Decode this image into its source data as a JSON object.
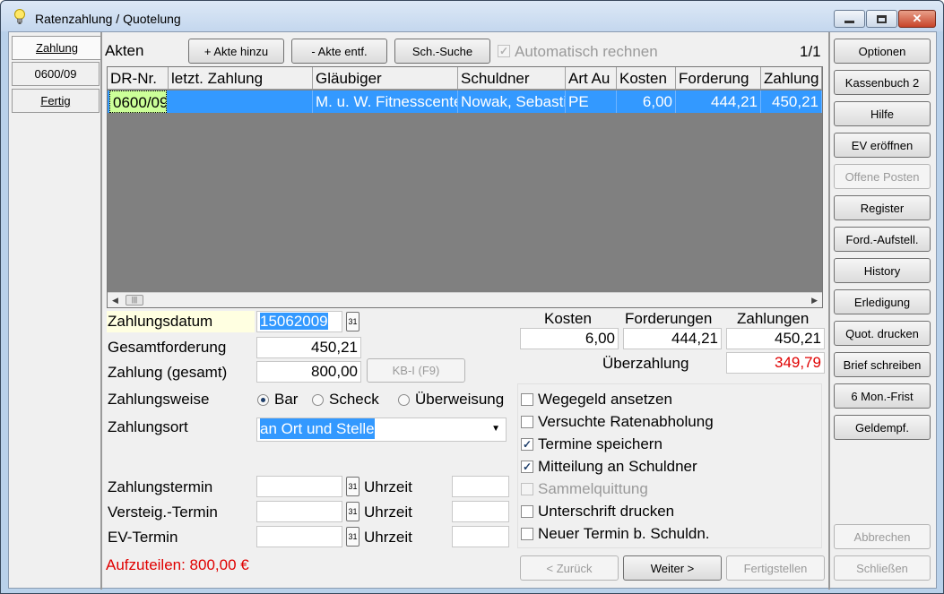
{
  "window": {
    "title": "Ratenzahlung / Quotelung",
    "minimize": "minimize",
    "maximize": "maximize",
    "close": "✕"
  },
  "left_tabs": [
    {
      "label": "Zahlung",
      "active": true
    },
    {
      "label": "0600/09",
      "active": false
    },
    {
      "label": "Fertig",
      "active": false
    }
  ],
  "akten": {
    "label": "Akten",
    "add_button": "+ Akte hinzu",
    "remove_button": "- Akte entf.",
    "search_button": "Sch.-Suche",
    "auto_calc_label": "Automatisch rechnen",
    "auto_calc_checked": true,
    "page_indicator": "1/1"
  },
  "grid": {
    "columns": [
      "DR-Nr.",
      "letzt. Zahlung",
      "Gläubiger",
      "Schuldner",
      "Art Au",
      "Kosten",
      "Forderung",
      "Zahlung"
    ],
    "rows": [
      [
        "0600/09",
        "",
        "M. u. W. Fitnesscenter",
        "Nowak, Sebastian",
        "PE",
        "6,00",
        "444,21",
        "450,21"
      ]
    ]
  },
  "form": {
    "zahlungsdatum_label": "Zahlungsdatum",
    "zahlungsdatum_value": "15062009",
    "gesamtforderung_label": "Gesamtforderung",
    "gesamtforderung_value": "450,21",
    "zahlung_label": "Zahlung (gesamt)",
    "zahlung_value": "800,00",
    "kb_button": "KB-I (F9)",
    "zahlungsweise_label": "Zahlungsweise",
    "zahlungsweise_options": [
      "Bar",
      "Scheck",
      "Überweisung"
    ],
    "zahlungsweise_selected": "Bar",
    "zahlungsort_label": "Zahlungsort",
    "zahlungsort_value": "an Ort und Stelle",
    "zahlungstermin_label": "Zahlungstermin",
    "versteig_label": "Versteig.-Termin",
    "ev_label": "EV-Termin",
    "uhrzeit_label": "Uhrzeit",
    "aufzuteilen": "Aufzuteilen: 800,00 €"
  },
  "summary": {
    "kosten_label": "Kosten",
    "forderungen_label": "Forderungen",
    "zahlungen_label": "Zahlungen",
    "kosten_value": "6,00",
    "forderungen_value": "444,21",
    "zahlungen_value": "450,21",
    "ueberzahlung_label": "Überzahlung",
    "ueberzahlung_value": "349,79"
  },
  "options": [
    {
      "label": "Wegegeld ansetzen",
      "checked": false,
      "disabled": false
    },
    {
      "label": "Versuchte Ratenabholung",
      "checked": false,
      "disabled": false
    },
    {
      "label": "Termine speichern",
      "checked": true,
      "disabled": false
    },
    {
      "label": "Mitteilung an Schuldner",
      "checked": true,
      "disabled": false
    },
    {
      "label": "Sammelquittung",
      "checked": false,
      "disabled": true
    },
    {
      "label": "Unterschrift drucken",
      "checked": false,
      "disabled": false
    },
    {
      "label": "Neuer Termin b. Schuldn.",
      "checked": false,
      "disabled": false
    }
  ],
  "nav": {
    "back": "< Zurück",
    "next": "Weiter >",
    "finish": "Fertigstellen"
  },
  "side_buttons": [
    {
      "label": "Optionen",
      "disabled": false
    },
    {
      "label": "Kassenbuch 2",
      "disabled": false
    },
    {
      "label": "Hilfe",
      "disabled": false
    },
    {
      "label": "EV eröffnen",
      "disabled": false
    },
    {
      "label": "Offene Posten",
      "disabled": true
    },
    {
      "label": "Register",
      "disabled": false
    },
    {
      "label": "Ford.-Aufstell.",
      "disabled": false
    },
    {
      "label": "History",
      "disabled": false
    },
    {
      "label": "Erledigung",
      "disabled": false
    },
    {
      "label": "Quot. drucken",
      "disabled": false
    },
    {
      "label": "Brief schreiben",
      "disabled": false
    },
    {
      "label": "6 Mon.-Frist",
      "disabled": false
    },
    {
      "label": "Geldempf.",
      "disabled": false
    }
  ],
  "bottom_buttons": {
    "cancel": "Abbrechen",
    "close": "Schließen"
  },
  "colors": {
    "selection": "#3399ff",
    "first_cell": "#ccff99",
    "red_text": "#e00000",
    "date_label_bg": "#ffffe1"
  }
}
